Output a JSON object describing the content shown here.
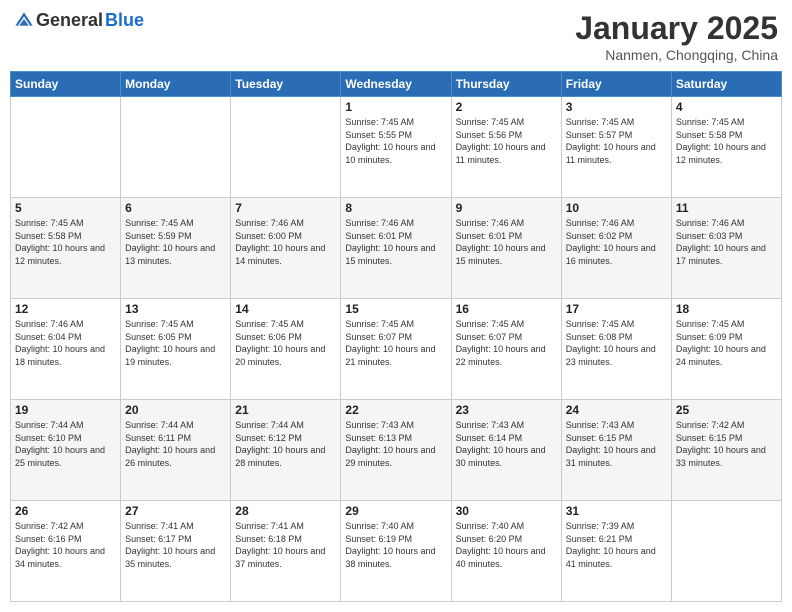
{
  "logo": {
    "general": "General",
    "blue": "Blue"
  },
  "title": {
    "month_year": "January 2025",
    "location": "Nanmen, Chongqing, China"
  },
  "days_of_week": [
    "Sunday",
    "Monday",
    "Tuesday",
    "Wednesday",
    "Thursday",
    "Friday",
    "Saturday"
  ],
  "weeks": [
    [
      {
        "day": "",
        "sunrise": "",
        "sunset": "",
        "daylight": ""
      },
      {
        "day": "",
        "sunrise": "",
        "sunset": "",
        "daylight": ""
      },
      {
        "day": "",
        "sunrise": "",
        "sunset": "",
        "daylight": ""
      },
      {
        "day": "1",
        "sunrise": "Sunrise: 7:45 AM",
        "sunset": "Sunset: 5:55 PM",
        "daylight": "Daylight: 10 hours and 10 minutes."
      },
      {
        "day": "2",
        "sunrise": "Sunrise: 7:45 AM",
        "sunset": "Sunset: 5:56 PM",
        "daylight": "Daylight: 10 hours and 11 minutes."
      },
      {
        "day": "3",
        "sunrise": "Sunrise: 7:45 AM",
        "sunset": "Sunset: 5:57 PM",
        "daylight": "Daylight: 10 hours and 11 minutes."
      },
      {
        "day": "4",
        "sunrise": "Sunrise: 7:45 AM",
        "sunset": "Sunset: 5:58 PM",
        "daylight": "Daylight: 10 hours and 12 minutes."
      }
    ],
    [
      {
        "day": "5",
        "sunrise": "Sunrise: 7:45 AM",
        "sunset": "Sunset: 5:58 PM",
        "daylight": "Daylight: 10 hours and 12 minutes."
      },
      {
        "day": "6",
        "sunrise": "Sunrise: 7:45 AM",
        "sunset": "Sunset: 5:59 PM",
        "daylight": "Daylight: 10 hours and 13 minutes."
      },
      {
        "day": "7",
        "sunrise": "Sunrise: 7:46 AM",
        "sunset": "Sunset: 6:00 PM",
        "daylight": "Daylight: 10 hours and 14 minutes."
      },
      {
        "day": "8",
        "sunrise": "Sunrise: 7:46 AM",
        "sunset": "Sunset: 6:01 PM",
        "daylight": "Daylight: 10 hours and 15 minutes."
      },
      {
        "day": "9",
        "sunrise": "Sunrise: 7:46 AM",
        "sunset": "Sunset: 6:01 PM",
        "daylight": "Daylight: 10 hours and 15 minutes."
      },
      {
        "day": "10",
        "sunrise": "Sunrise: 7:46 AM",
        "sunset": "Sunset: 6:02 PM",
        "daylight": "Daylight: 10 hours and 16 minutes."
      },
      {
        "day": "11",
        "sunrise": "Sunrise: 7:46 AM",
        "sunset": "Sunset: 6:03 PM",
        "daylight": "Daylight: 10 hours and 17 minutes."
      }
    ],
    [
      {
        "day": "12",
        "sunrise": "Sunrise: 7:46 AM",
        "sunset": "Sunset: 6:04 PM",
        "daylight": "Daylight: 10 hours and 18 minutes."
      },
      {
        "day": "13",
        "sunrise": "Sunrise: 7:45 AM",
        "sunset": "Sunset: 6:05 PM",
        "daylight": "Daylight: 10 hours and 19 minutes."
      },
      {
        "day": "14",
        "sunrise": "Sunrise: 7:45 AM",
        "sunset": "Sunset: 6:06 PM",
        "daylight": "Daylight: 10 hours and 20 minutes."
      },
      {
        "day": "15",
        "sunrise": "Sunrise: 7:45 AM",
        "sunset": "Sunset: 6:07 PM",
        "daylight": "Daylight: 10 hours and 21 minutes."
      },
      {
        "day": "16",
        "sunrise": "Sunrise: 7:45 AM",
        "sunset": "Sunset: 6:07 PM",
        "daylight": "Daylight: 10 hours and 22 minutes."
      },
      {
        "day": "17",
        "sunrise": "Sunrise: 7:45 AM",
        "sunset": "Sunset: 6:08 PM",
        "daylight": "Daylight: 10 hours and 23 minutes."
      },
      {
        "day": "18",
        "sunrise": "Sunrise: 7:45 AM",
        "sunset": "Sunset: 6:09 PM",
        "daylight": "Daylight: 10 hours and 24 minutes."
      }
    ],
    [
      {
        "day": "19",
        "sunrise": "Sunrise: 7:44 AM",
        "sunset": "Sunset: 6:10 PM",
        "daylight": "Daylight: 10 hours and 25 minutes."
      },
      {
        "day": "20",
        "sunrise": "Sunrise: 7:44 AM",
        "sunset": "Sunset: 6:11 PM",
        "daylight": "Daylight: 10 hours and 26 minutes."
      },
      {
        "day": "21",
        "sunrise": "Sunrise: 7:44 AM",
        "sunset": "Sunset: 6:12 PM",
        "daylight": "Daylight: 10 hours and 28 minutes."
      },
      {
        "day": "22",
        "sunrise": "Sunrise: 7:43 AM",
        "sunset": "Sunset: 6:13 PM",
        "daylight": "Daylight: 10 hours and 29 minutes."
      },
      {
        "day": "23",
        "sunrise": "Sunrise: 7:43 AM",
        "sunset": "Sunset: 6:14 PM",
        "daylight": "Daylight: 10 hours and 30 minutes."
      },
      {
        "day": "24",
        "sunrise": "Sunrise: 7:43 AM",
        "sunset": "Sunset: 6:15 PM",
        "daylight": "Daylight: 10 hours and 31 minutes."
      },
      {
        "day": "25",
        "sunrise": "Sunrise: 7:42 AM",
        "sunset": "Sunset: 6:15 PM",
        "daylight": "Daylight: 10 hours and 33 minutes."
      }
    ],
    [
      {
        "day": "26",
        "sunrise": "Sunrise: 7:42 AM",
        "sunset": "Sunset: 6:16 PM",
        "daylight": "Daylight: 10 hours and 34 minutes."
      },
      {
        "day": "27",
        "sunrise": "Sunrise: 7:41 AM",
        "sunset": "Sunset: 6:17 PM",
        "daylight": "Daylight: 10 hours and 35 minutes."
      },
      {
        "day": "28",
        "sunrise": "Sunrise: 7:41 AM",
        "sunset": "Sunset: 6:18 PM",
        "daylight": "Daylight: 10 hours and 37 minutes."
      },
      {
        "day": "29",
        "sunrise": "Sunrise: 7:40 AM",
        "sunset": "Sunset: 6:19 PM",
        "daylight": "Daylight: 10 hours and 38 minutes."
      },
      {
        "day": "30",
        "sunrise": "Sunrise: 7:40 AM",
        "sunset": "Sunset: 6:20 PM",
        "daylight": "Daylight: 10 hours and 40 minutes."
      },
      {
        "day": "31",
        "sunrise": "Sunrise: 7:39 AM",
        "sunset": "Sunset: 6:21 PM",
        "daylight": "Daylight: 10 hours and 41 minutes."
      },
      {
        "day": "",
        "sunrise": "",
        "sunset": "",
        "daylight": ""
      }
    ]
  ]
}
